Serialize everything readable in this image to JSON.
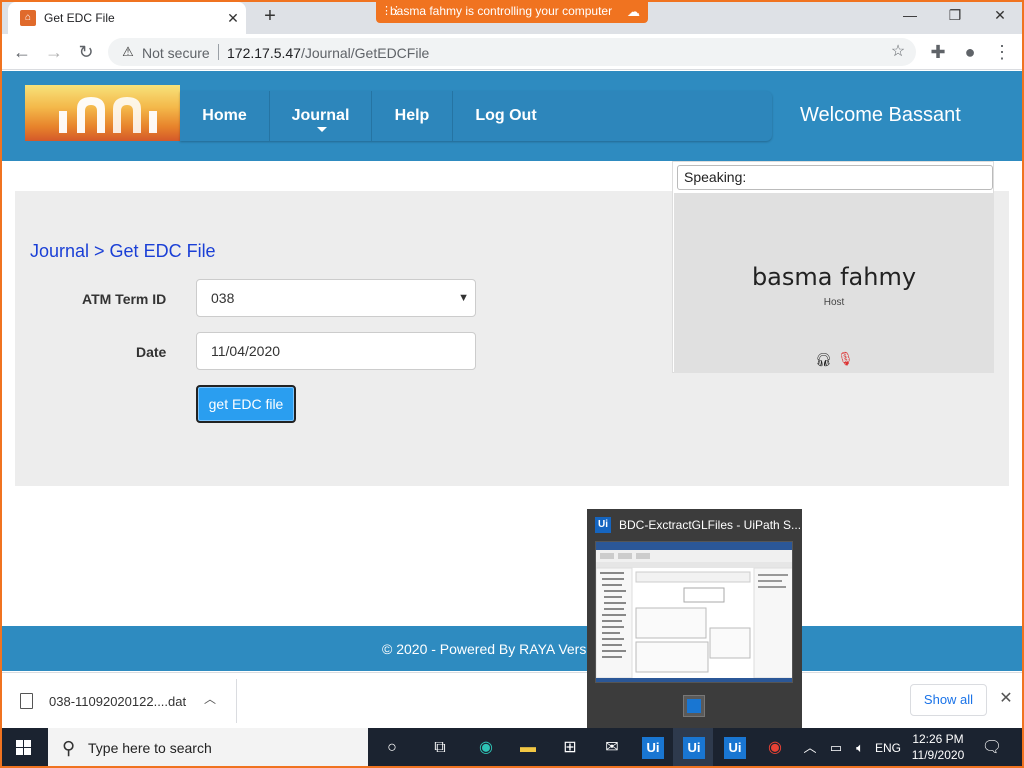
{
  "browser": {
    "tab_title": "Get EDC File",
    "tab_favicon": "bank-logo-icon",
    "share_banner": "basma fahmy is controlling your computer",
    "security_label": "Not secure",
    "url_host": "172.17.5.47",
    "url_path": "/Journal/GetEDCFile"
  },
  "header": {
    "nav": [
      {
        "label": "Home"
      },
      {
        "label": "Journal"
      },
      {
        "label": "Help"
      },
      {
        "label": "Log Out"
      }
    ],
    "welcome": "Welcome Bassant",
    "brand_color": "#2e8bc0"
  },
  "form": {
    "breadcrumb": "Journal > Get EDC File",
    "atm_label": "ATM Term ID",
    "atm_value": "038",
    "date_label": "Date",
    "date_value": "11/04/2020",
    "submit_label": "get EDC file"
  },
  "speaking": {
    "label": "Speaking:",
    "name": "basma fahmy",
    "role": "Host"
  },
  "footer": {
    "text": "© 2020 - Powered By RAYA Vers"
  },
  "downloads": {
    "filename": "038-11092020122....dat",
    "show_all": "Show all"
  },
  "thumbnail": {
    "title": "BDC-ExctractGLFiles - UiPath S..."
  },
  "taskbar": {
    "search_placeholder": "Type here to search",
    "ui_label": "Ui",
    "lang": "ENG",
    "time": "12:26 PM",
    "date": "11/9/2020"
  }
}
